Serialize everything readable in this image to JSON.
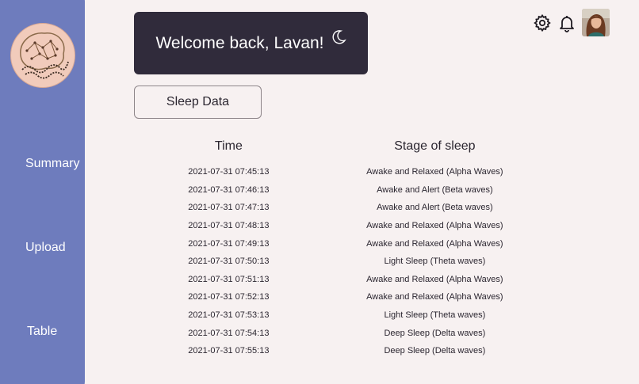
{
  "sidebar": {
    "logo_icon": "brain-logo-icon",
    "items": [
      {
        "label": "Summary"
      },
      {
        "label": "Upload"
      },
      {
        "label": "Table"
      }
    ]
  },
  "header": {
    "welcome_text": "Welcome back, Lavan!",
    "welcome_icon": "moon-icon",
    "icons": [
      "gear-icon",
      "bell-icon"
    ],
    "avatar": "user-avatar"
  },
  "main": {
    "sleep_data_button": "Sleep Data",
    "table": {
      "columns": [
        "Time",
        "Stage of sleep"
      ],
      "rows": [
        {
          "time": "2021-07-31 07:45:13",
          "stage": "Awake and Relaxed (Alpha Waves)"
        },
        {
          "time": "2021-07-31 07:46:13",
          "stage": "Awake and Alert (Beta waves)"
        },
        {
          "time": "2021-07-31 07:47:13",
          "stage": "Awake and Alert (Beta waves)"
        },
        {
          "time": "2021-07-31 07:48:13",
          "stage": "Awake and Relaxed (Alpha Waves)"
        },
        {
          "time": "2021-07-31 07:49:13",
          "stage": "Awake and Relaxed (Alpha Waves)"
        },
        {
          "time": "2021-07-31 07:50:13",
          "stage": "Light Sleep (Theta waves)"
        },
        {
          "time": "2021-07-31 07:51:13",
          "stage": "Awake and Relaxed (Alpha Waves)"
        },
        {
          "time": "2021-07-31 07:52:13",
          "stage": "Awake and Relaxed (Alpha Waves)"
        },
        {
          "time": "2021-07-31 07:53:13",
          "stage": "Light Sleep (Theta waves)"
        },
        {
          "time": "2021-07-31 07:54:13",
          "stage": "Deep Sleep (Delta waves)"
        },
        {
          "time": "2021-07-31 07:55:13",
          "stage": "Deep Sleep (Delta waves)"
        }
      ]
    }
  },
  "colors": {
    "sidebar": "#6e7cbd",
    "background": "#f7f1f1",
    "welcome_card": "#302b3b",
    "logo_bg": "#f1cbbb"
  }
}
